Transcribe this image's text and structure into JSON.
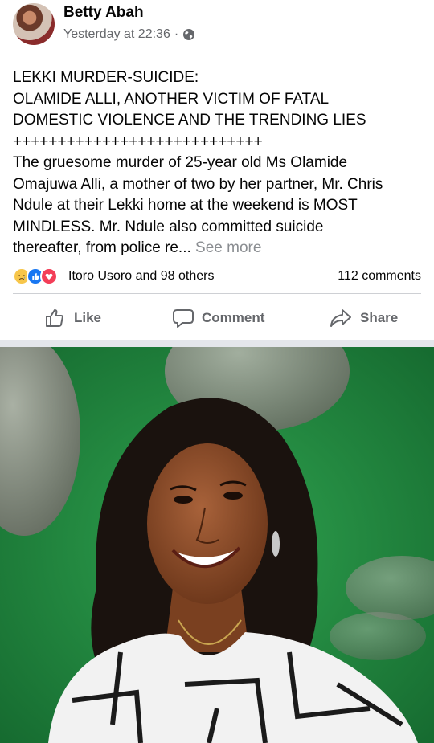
{
  "post": {
    "author": "Betty Abah",
    "timestamp": "Yesterday at 22:36",
    "separator": "·",
    "text_lines": [
      "LEKKI MURDER-SUICIDE:",
      "OLAMIDE ALLI, ANOTHER VICTIM OF FATAL",
      "DOMESTIC VIOLENCE AND THE TRENDING LIES",
      "++++++++++++++++++++++++++++",
      "The gruesome murder of 25-year old Ms Olamide",
      "Omajuwa Alli, a mother of two by her partner, Mr. Chris",
      "Ndule at their Lekki home at the weekend is MOST",
      "MINDLESS. Mr. Ndule also committed suicide",
      "thereafter, from police re..."
    ],
    "see_more": "See more"
  },
  "reactions": {
    "icons": [
      "sad-reaction-icon",
      "like-reaction-icon",
      "love-reaction-icon"
    ],
    "summary": "Itoro Usoro and 98 others",
    "comments": "112 comments"
  },
  "actions": {
    "like": "Like",
    "comment": "Comment",
    "share": "Share"
  },
  "colors": {
    "text": "#050505",
    "secondary": "#65676b",
    "see_more": "#8a8d91",
    "like_blue": "#1877f2",
    "love_red": "#f33e58",
    "sad_yellow": "#f7c64a",
    "photo_background": "#1f8a3f"
  }
}
